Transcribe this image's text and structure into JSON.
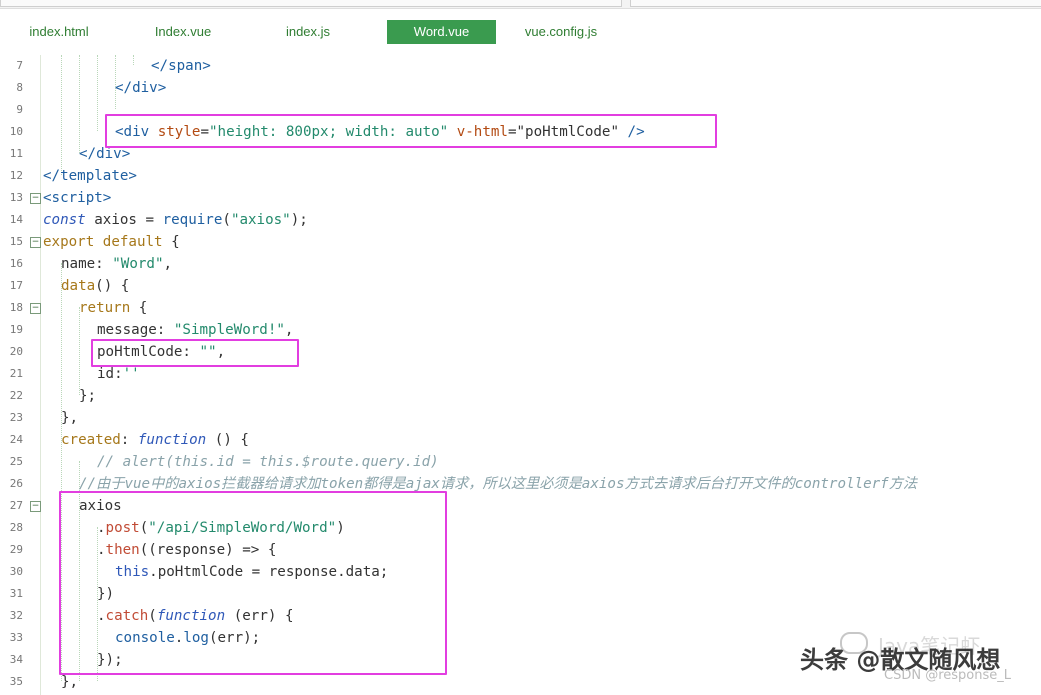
{
  "tabs": [
    {
      "label": "index.html",
      "active": false
    },
    {
      "label": "Index.vue",
      "active": false
    },
    {
      "label": "index.js",
      "active": false
    },
    {
      "label": "Word.vue",
      "active": true
    },
    {
      "label": "vue.config.js",
      "active": false
    }
  ],
  "colors": {
    "active_tab": "#3a9b4f",
    "highlight_box": "#e23ee0",
    "tab_text": "#2f7d32"
  },
  "code": {
    "line_numbers": [
      "7",
      "8",
      "9",
      "10",
      "11",
      "12",
      "13",
      "14",
      "15",
      "16",
      "17",
      "18",
      "19",
      "20",
      "21",
      "22",
      "23",
      "24",
      "25",
      "26",
      "27",
      "28",
      "29",
      "30",
      "31",
      "32",
      "33",
      "34",
      "35"
    ],
    "lines": {
      "l7_tag": "</span>",
      "l8_tag": "</div>",
      "l10_open": "<div",
      "l10_attr1": "style",
      "l10_val1": "\"height: 800px; width: auto\"",
      "l10_attr2": "v-html",
      "l10_val2": "\"poHtmlCode\"",
      "l10_close": "/>",
      "l11_tag": "</div>",
      "l12_tag": "</template>",
      "l13_tag": "<script>",
      "l14_kw": "const",
      "l14_mid": " axios = ",
      "l14_fn": "require",
      "l14_args_open": "(",
      "l14_str": "\"axios\"",
      "l14_end": ");",
      "l15_kw": "export default",
      "l15_end": " {",
      "l16_key": "name: ",
      "l16_str": "\"Word\"",
      "l16_end": ",",
      "l17_fn": "data",
      "l17_end": "() {",
      "l18_kw": "return",
      "l18_end": " {",
      "l19_key": "message: ",
      "l19_str": "\"SimpleWord!\"",
      "l19_end": ",",
      "l20_key": "poHtmlCode: ",
      "l20_str": "\"\"",
      "l20_end": ",",
      "l21_key": "id:",
      "l21_str": "''",
      "l22": "};",
      "l23": "},",
      "l24_kw": "created",
      "l24_mid": ": ",
      "l24_fn": "function",
      "l24_end": " () {",
      "l25_comment": "// alert(this.id = this.$route.query.id)",
      "l26_comment": "//由于vue中的axios拦截器给请求加token都得是ajax请求，所以这里必须是axios方式去请求后台打开文件的controllerf方法",
      "l27": "axios",
      "l28_dot": ".",
      "l28_fn": "post",
      "l28_open": "(",
      "l28_str": "\"/api/SimpleWord/Word\"",
      "l28_end": ")",
      "l29_dot": ".",
      "l29_fn": "then",
      "l29_end": "((response) => {",
      "l30_this": "this",
      "l30_end": ".poHtmlCode = response.data;",
      "l31": "})",
      "l32_dot": ".",
      "l32_fn": "catch",
      "l32_open": "(",
      "l32_kw": "function",
      "l32_end": " (err) {",
      "l33_obj": "console",
      "l33_dot": ".",
      "l33_fn": "log",
      "l33_end": "(err);",
      "l34": "});",
      "l35": "},"
    }
  },
  "watermark": {
    "main": "头条 @散文随风想",
    "ghost": "Java笔记虾",
    "csdn": "CSDN @response_L"
  }
}
